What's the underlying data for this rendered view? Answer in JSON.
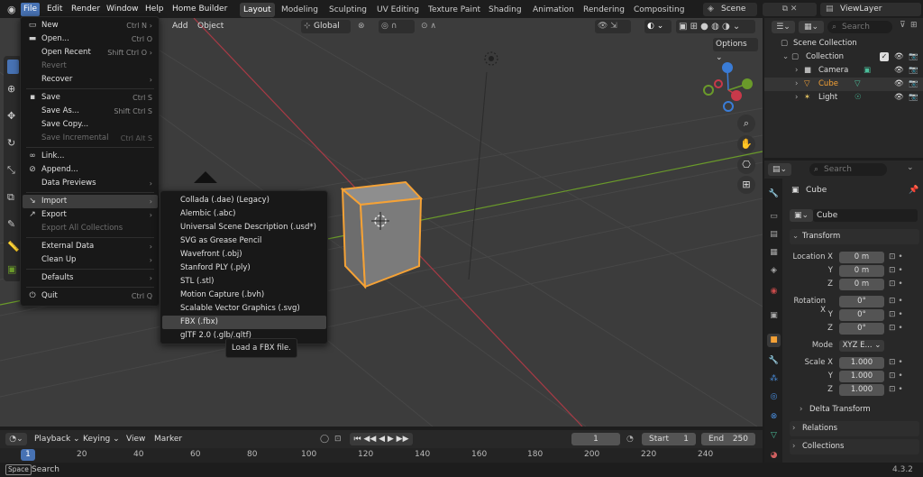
{
  "topbar": {
    "menus": [
      "File",
      "Edit",
      "Render",
      "Window",
      "Help",
      "Home Builder"
    ],
    "workspaces": [
      "Layout",
      "Modeling",
      "Sculpting",
      "UV Editing",
      "Texture Paint",
      "Shading",
      "Animation",
      "Rendering",
      "Compositing"
    ],
    "scene_label": "Scene",
    "viewlayer_label": "ViewLayer"
  },
  "viewport_header": {
    "add_label": "Add",
    "object_label": "Object",
    "transform_orientation": "Global",
    "options_label": "Options"
  },
  "file_menu": {
    "items": [
      {
        "label": "New",
        "shortcut": "Ctrl N",
        "icon": "new-file-icon",
        "submenu": true
      },
      {
        "label": "Open...",
        "shortcut": "Ctrl O",
        "icon": "folder-icon"
      },
      {
        "label": "Open Recent",
        "shortcut": "Shift Ctrl O",
        "submenu": true
      },
      {
        "label": "Revert",
        "disabled": true
      },
      {
        "label": "Recover",
        "submenu": true
      },
      {
        "label": "Save",
        "shortcut": "Ctrl S",
        "icon": "save-icon"
      },
      {
        "label": "Save As...",
        "shortcut": "Shift Ctrl S"
      },
      {
        "label": "Save Copy..."
      },
      {
        "label": "Save Incremental",
        "shortcut": "Ctrl Alt S",
        "disabled": true
      },
      {
        "label": "Link...",
        "icon": "link-icon"
      },
      {
        "label": "Append...",
        "icon": "append-icon"
      },
      {
        "label": "Data Previews",
        "submenu": true
      },
      {
        "label": "Import",
        "icon": "import-icon",
        "submenu": true,
        "highlighted": true
      },
      {
        "label": "Export",
        "icon": "export-icon",
        "submenu": true
      },
      {
        "label": "Export All Collections",
        "disabled": true
      },
      {
        "label": "External Data",
        "submenu": true
      },
      {
        "label": "Clean Up",
        "submenu": true
      },
      {
        "label": "Defaults",
        "submenu": true
      },
      {
        "label": "Quit",
        "shortcut": "Ctrl Q",
        "icon": "power-icon"
      }
    ]
  },
  "import_menu": {
    "items": [
      "Collada (.dae) (Legacy)",
      "Alembic (.abc)",
      "Universal Scene Description (.usd*)",
      "SVG as Grease Pencil",
      "Wavefront (.obj)",
      "Stanford PLY (.ply)",
      "STL (.stl)",
      "Motion Capture (.bvh)",
      "Scalable Vector Graphics (.svg)",
      "FBX (.fbx)",
      "glTF 2.0 (.glb/.gltf)"
    ],
    "highlighted_index": 9
  },
  "tooltip": "Load a FBX file.",
  "outliner": {
    "search_placeholder": "Search",
    "rows": [
      {
        "label": "Scene Collection",
        "indent": 0
      },
      {
        "label": "Collection",
        "indent": 1
      },
      {
        "label": "Camera",
        "indent": 2
      },
      {
        "label": "Cube",
        "indent": 2
      },
      {
        "label": "Light",
        "indent": 2
      }
    ]
  },
  "properties": {
    "search_placeholder": "Search",
    "object_name": "Cube",
    "datablock_name": "Cube",
    "transform_header": "Transform",
    "location_label": "Location X",
    "rotation_label": "Rotation X",
    "scale_label": "Scale X",
    "y_label": "Y",
    "z_label": "Z",
    "location": [
      "0 m",
      "0 m",
      "0 m"
    ],
    "rotation": [
      "0°",
      "0°",
      "0°"
    ],
    "scale": [
      "1.000",
      "1.000",
      "1.000"
    ],
    "mode_label": "Mode",
    "mode_value": "XYZ E...",
    "delta_transform": "Delta Transform",
    "relations": "Relations",
    "collections": "Collections"
  },
  "timeline": {
    "playback": "Playback",
    "keying": "Keying",
    "view": "View",
    "marker": "Marker",
    "current_frame": "1",
    "start_label": "Start",
    "start_value": "1",
    "end_label": "End",
    "end_value": "250",
    "ruler": [
      "1",
      "20",
      "40",
      "60",
      "80",
      "100",
      "120",
      "140",
      "160",
      "180",
      "200",
      "220",
      "240"
    ]
  },
  "statusbar": {
    "key": "Space",
    "action": "Search",
    "version": "4.3.2"
  },
  "colors": {
    "accent": "#4772b3",
    "selection_orange": "#f5a236",
    "axis_x": "#c8394a",
    "axis_y": "#6a9a2a",
    "axis_z": "#3a7cd6"
  }
}
